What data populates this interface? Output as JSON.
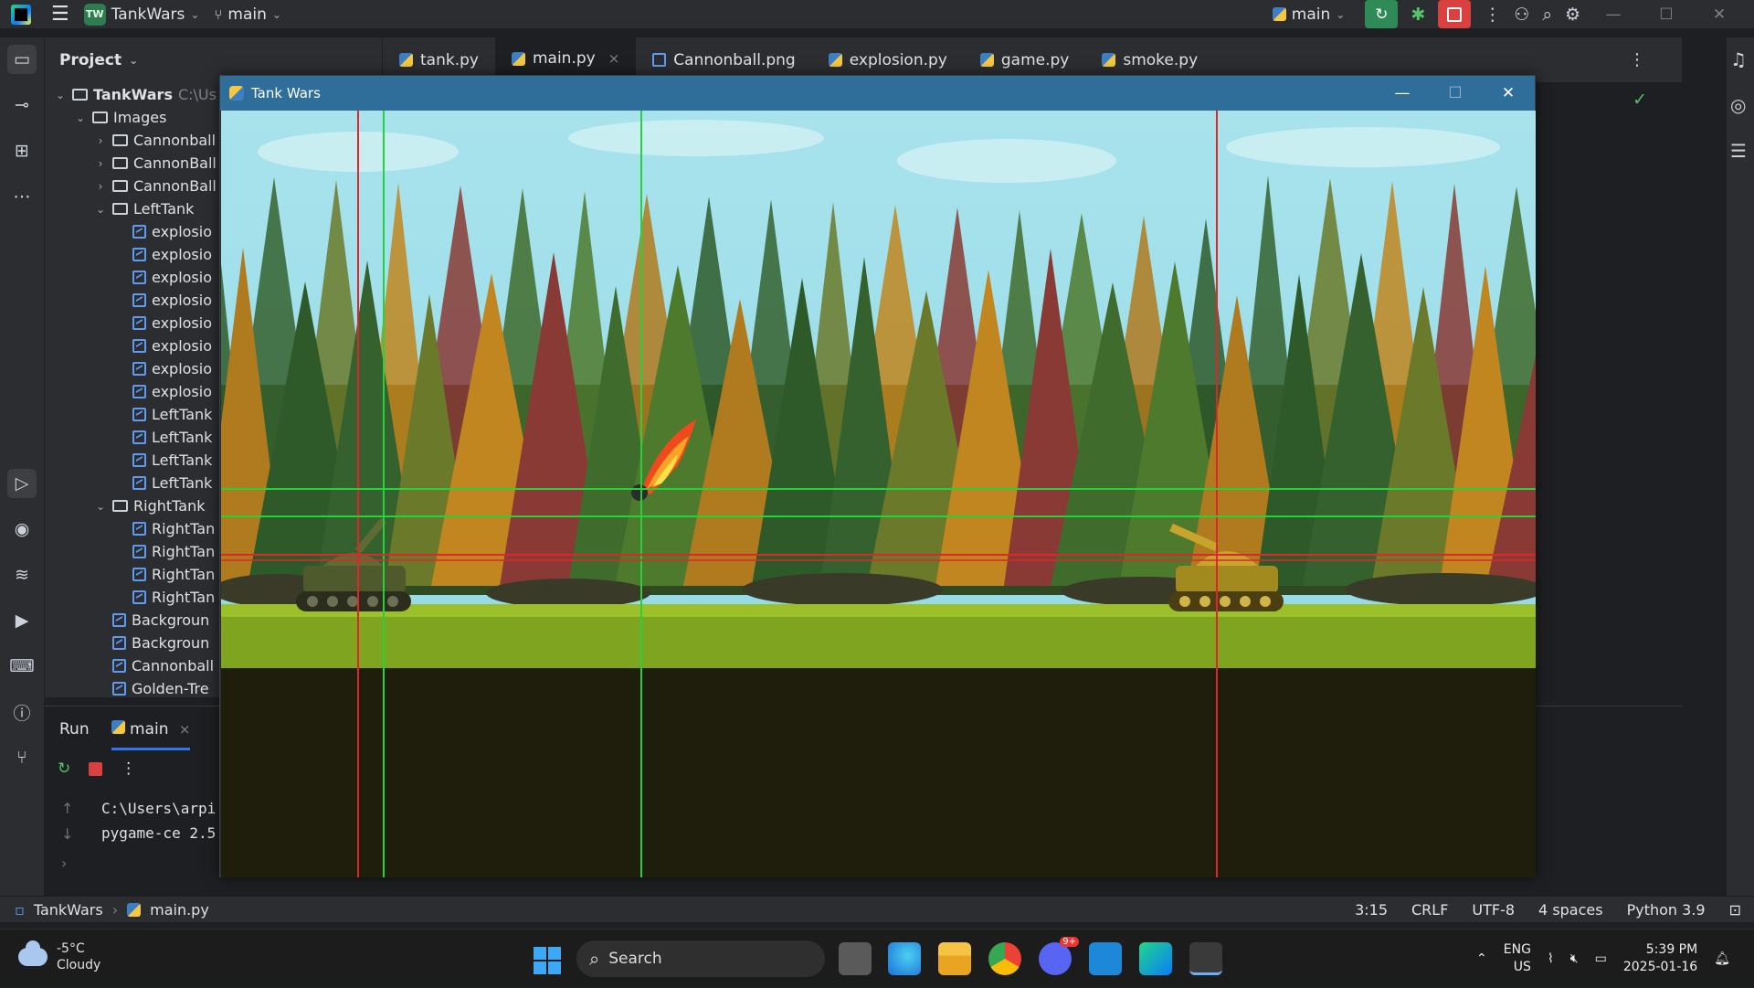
{
  "ide": {
    "project_name": "TankWars",
    "project_badge": "TW",
    "branch": "main",
    "run_config": "main",
    "window_controls": [
      "minimize",
      "maximize",
      "close"
    ]
  },
  "project_panel": {
    "title": "Project",
    "root": {
      "name": "TankWars",
      "path": "C:\\Us"
    },
    "rows": [
      {
        "label": "Images",
        "type": "folder",
        "depth": 1,
        "expanded": true
      },
      {
        "label": "Cannonball",
        "type": "folder",
        "depth": 2,
        "expanded": false
      },
      {
        "label": "CannonBall",
        "type": "folder",
        "depth": 2,
        "expanded": false
      },
      {
        "label": "CannonBall",
        "type": "folder",
        "depth": 2,
        "expanded": false
      },
      {
        "label": "LeftTank",
        "type": "folder",
        "depth": 2,
        "expanded": true
      },
      {
        "label": "explosio",
        "type": "image",
        "depth": 3
      },
      {
        "label": "explosio",
        "type": "image",
        "depth": 3
      },
      {
        "label": "explosio",
        "type": "image",
        "depth": 3
      },
      {
        "label": "explosio",
        "type": "image",
        "depth": 3
      },
      {
        "label": "explosio",
        "type": "image",
        "depth": 3
      },
      {
        "label": "explosio",
        "type": "image",
        "depth": 3
      },
      {
        "label": "explosio",
        "type": "image",
        "depth": 3
      },
      {
        "label": "explosio",
        "type": "image",
        "depth": 3
      },
      {
        "label": "LeftTank",
        "type": "image",
        "depth": 3
      },
      {
        "label": "LeftTank",
        "type": "image",
        "depth": 3
      },
      {
        "label": "LeftTank",
        "type": "image",
        "depth": 3
      },
      {
        "label": "LeftTank",
        "type": "image",
        "depth": 3
      },
      {
        "label": "RightTank",
        "type": "folder",
        "depth": 2,
        "expanded": true
      },
      {
        "label": "RightTan",
        "type": "image",
        "depth": 3
      },
      {
        "label": "RightTan",
        "type": "image",
        "depth": 3
      },
      {
        "label": "RightTan",
        "type": "image",
        "depth": 3
      },
      {
        "label": "RightTan",
        "type": "image",
        "depth": 3
      },
      {
        "label": "Backgroun",
        "type": "image",
        "depth": 2
      },
      {
        "label": "Backgroun",
        "type": "image",
        "depth": 2
      },
      {
        "label": "Cannonball",
        "type": "image",
        "depth": 2
      },
      {
        "label": "Golden-Tre",
        "type": "image",
        "depth": 2
      }
    ]
  },
  "editor_tabs": [
    {
      "label": "tank.py",
      "kind": "python",
      "active": false
    },
    {
      "label": "main.py",
      "kind": "python",
      "active": true
    },
    {
      "label": "Cannonball.png",
      "kind": "image",
      "active": false
    },
    {
      "label": "explosion.py",
      "kind": "python",
      "active": false
    },
    {
      "label": "game.py",
      "kind": "python",
      "active": false
    },
    {
      "label": "smoke.py",
      "kind": "python",
      "active": false
    }
  ],
  "run_panel": {
    "title": "Run",
    "tab": "main",
    "console_lines": [
      "C:\\Users\\arpi",
      "pygame-ce 2.5"
    ]
  },
  "status_bar": {
    "breadcrumb": [
      "TankWars",
      "main.py"
    ],
    "position": "3:15",
    "line_sep": "CRLF",
    "encoding": "UTF-8",
    "indent": "4 spaces",
    "interpreter": "Python 3.9"
  },
  "game_window": {
    "title": "Tank Wars",
    "colors": {
      "sky": "#a8e3ec",
      "grass": "#7fa41f",
      "ground": "#1f1e0c",
      "debug_red": "#e0262a",
      "debug_green": "#22d33a"
    }
  },
  "taskbar": {
    "weather_temp": "-5°C",
    "weather_desc": "Cloudy",
    "search_label": "Search",
    "notification_count": "9+",
    "lang_1": "ENG",
    "lang_2": "US",
    "time": "5:39 PM",
    "date": "2025-01-16"
  }
}
